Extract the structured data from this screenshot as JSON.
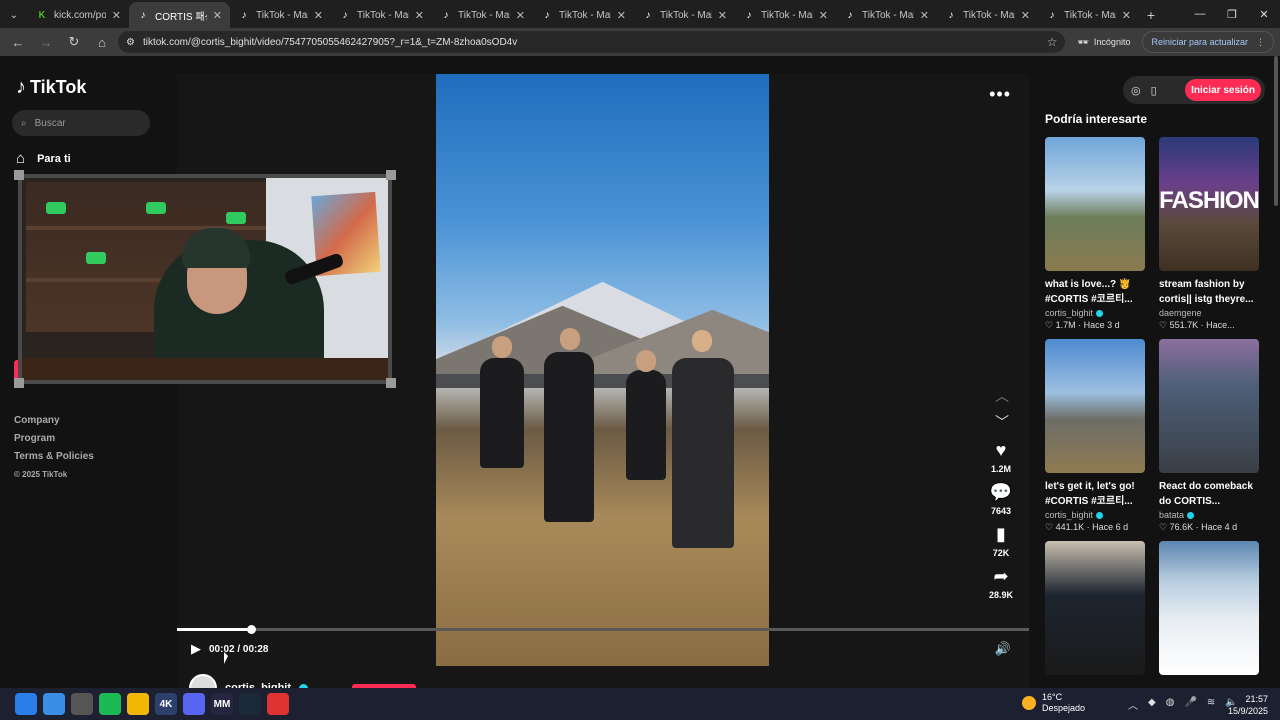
{
  "browser": {
    "tabs": [
      {
        "title": "kick.com/popo",
        "icon": "kick-icon",
        "color": "#53fc18",
        "active": false
      },
      {
        "title": "CORTIS 패션 스",
        "icon": "tiktok-icon",
        "color": "#ffffff",
        "active": true
      },
      {
        "title": "TikTok - Make",
        "icon": "tiktok-icon",
        "color": "#ffffff",
        "active": false
      },
      {
        "title": "TikTok - Make",
        "icon": "tiktok-icon",
        "color": "#ffffff",
        "active": false
      },
      {
        "title": "TikTok - Make",
        "icon": "tiktok-icon",
        "color": "#ffffff",
        "active": false
      },
      {
        "title": "TikTok - Make",
        "icon": "tiktok-icon",
        "color": "#ffffff",
        "active": false
      },
      {
        "title": "TikTok - Make",
        "icon": "tiktok-icon",
        "color": "#ffffff",
        "active": false
      },
      {
        "title": "TikTok - Make",
        "icon": "tiktok-icon",
        "color": "#ffffff",
        "active": false
      },
      {
        "title": "TikTok - Make",
        "icon": "tiktok-icon",
        "color": "#ffffff",
        "active": false
      },
      {
        "title": "TikTok - Make",
        "icon": "tiktok-icon",
        "color": "#ffffff",
        "active": false
      },
      {
        "title": "TikTok - Make",
        "icon": "tiktok-icon",
        "color": "#ffffff",
        "active": false
      }
    ],
    "url": "tiktok.com/@cortis_bighit/video/7547705055462427905?_r=1&_t=ZM-8zhoa0sOD4v",
    "incognito_label": "Incógnito",
    "refresh_label": "Reiniciar para actualizar"
  },
  "sidebar": {
    "logo": "TikTok",
    "search_placeholder": "Buscar",
    "nav_home": "Para ti",
    "footer": [
      "Company",
      "Program",
      "Terms & Policies"
    ],
    "copyright": "© 2025 TikTok"
  },
  "player": {
    "likes": "1.2M",
    "comments": "7643",
    "saves": "72K",
    "shares": "28.9K",
    "current_time": "00:02",
    "duration": "00:28",
    "time_display": "00:02 / 00:28",
    "progress_fraction": 0.087,
    "author": "cortis_bighit"
  },
  "right": {
    "login_label": "Iniciar sesión",
    "heading": "Podría interesarte",
    "cards": [
      {
        "caption": "what is love...? 🫅 #CORTIS #코르티...",
        "author": "cortis_bighit",
        "verified": true,
        "meta": "♡ 1.7M · Hace 3 d",
        "thumb": "linear-gradient(180deg,#6fa6d8 0%,#b9d2e8 40%,#6d7d5a 60%,#8a7a50 100%)"
      },
      {
        "caption": "stream fashion by cortis|| istg theyre...",
        "author": "daemgene",
        "verified": false,
        "meta": "♡ 551.7K · Hace...",
        "thumb": "linear-gradient(180deg,#2a3a78 0%,#6b3f8a 35%,#5a4a3a 65%,#3d3023 100%)",
        "overlay": "FASHION"
      },
      {
        "caption": "let's get it, let's go! #CORTIS #코르티...",
        "author": "cortis_bighit",
        "verified": true,
        "meta": "♡ 441.1K · Hace 6 d",
        "thumb": "linear-gradient(180deg,#4d8ad0 0%,#9dc0e0 40%,#6d6d68 60%,#8f7b52 100%)"
      },
      {
        "caption": "React do comeback do CORTIS...",
        "author": "batata",
        "verified": true,
        "meta": "♡ 76.6K · Hace 4 d",
        "thumb": "linear-gradient(180deg,#8c6f9e 0%,#4d5f78 35%,#3a3f46 100%)"
      },
      {
        "caption": "",
        "author": "",
        "verified": false,
        "meta": "",
        "thumb": "linear-gradient(180deg,#c9c0b0 0%,#1d2530 40%,#1a1a1a 100%)"
      },
      {
        "caption": "",
        "author": "",
        "verified": false,
        "meta": "",
        "thumb": "linear-gradient(180deg,#5d86b0 0%,#b9cde0 30%,#e9eef3 60%,#ffffff 100%)"
      }
    ]
  },
  "taskbar": {
    "weather_temp": "16°C",
    "weather_desc": "Despejado",
    "time": "21:57",
    "date": "15/9/2025",
    "apps": [
      {
        "name": "windows-start-icon",
        "color": "#2b7de9",
        "label": ""
      },
      {
        "name": "chrome-icon",
        "color": "#3a8ee6",
        "label": ""
      },
      {
        "name": "chrome-incognito-icon",
        "color": "#555",
        "label": ""
      },
      {
        "name": "spotify-icon",
        "color": "#1db954",
        "label": ""
      },
      {
        "name": "file-explorer-icon",
        "color": "#f2b705",
        "label": ""
      },
      {
        "name": "4k-icon",
        "color": "#2d3f6b",
        "label": "4K"
      },
      {
        "name": "discord-icon",
        "color": "#5865f2",
        "label": ""
      },
      {
        "name": "mm-icon",
        "color": "#262640",
        "label": "MM"
      },
      {
        "name": "steam-icon",
        "color": "#1b2838",
        "label": ""
      },
      {
        "name": "video-app-icon",
        "color": "#d33",
        "label": ""
      }
    ]
  }
}
